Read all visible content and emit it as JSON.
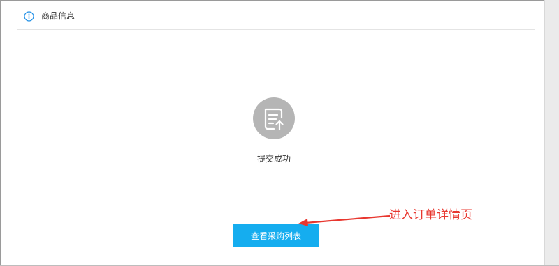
{
  "section": {
    "title": "商品信息",
    "icon": "info-icon"
  },
  "result": {
    "icon": "document-upload-icon",
    "message": "提交成功"
  },
  "actions": {
    "view_purchase_list_label": "查看采购列表"
  },
  "annotation": {
    "text": "进入订单详情页",
    "color": "#e8372f"
  },
  "colors": {
    "accent": "#15adef",
    "info_icon": "#1f8fe6",
    "success_icon_bg": "#b5b5b5"
  }
}
